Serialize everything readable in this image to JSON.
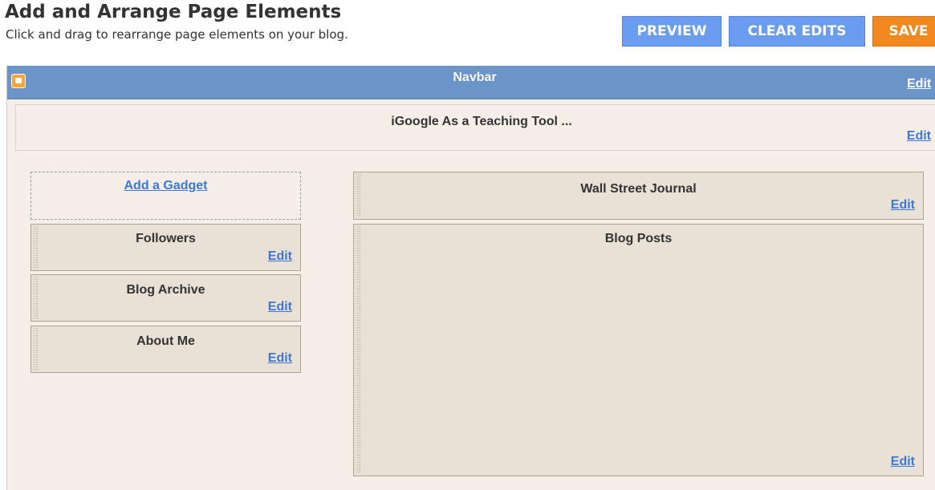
{
  "header": {
    "title": "Add and Arrange Page Elements",
    "subtitle": "Click and drag to rearrange page elements on your blog."
  },
  "toolbar": {
    "preview_label": "PREVIEW",
    "clear_label": "CLEAR EDITS",
    "save_label": "SAVE"
  },
  "colors": {
    "accent_blue": "#6a9cf0",
    "save_orange": "#f0881e",
    "navbar": "#6b95c8",
    "link": "#3c78d8"
  },
  "navbar": {
    "icon": "blogger-icon",
    "title": "Navbar",
    "edit_label": "Edit"
  },
  "blog_header": {
    "title": "iGoogle As a Teaching Tool ...",
    "edit_label": "Edit"
  },
  "sidebar": {
    "add_gadget_label": "Add a Gadget",
    "gadgets": [
      {
        "title": "Followers",
        "edit_label": "Edit"
      },
      {
        "title": "Blog Archive",
        "edit_label": "Edit"
      },
      {
        "title": "About Me",
        "edit_label": "Edit"
      }
    ]
  },
  "main": {
    "gadgets": [
      {
        "title": "Wall Street Journal",
        "edit_label": "Edit"
      },
      {
        "title": "Blog Posts",
        "edit_label": "Edit"
      }
    ]
  }
}
